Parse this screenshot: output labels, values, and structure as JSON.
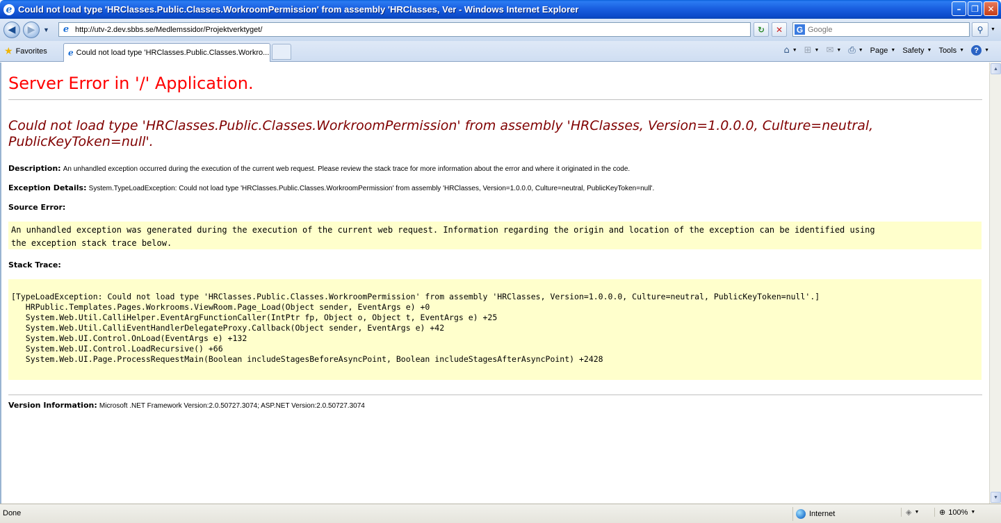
{
  "window": {
    "title": "Could not load type 'HRClasses.Public.Classes.WorkroomPermission' from assembly 'HRClasses, Ver - Windows Internet Explorer",
    "minimize": "–",
    "maximize": "❐",
    "close": "✕"
  },
  "address": {
    "back": "◀",
    "forward": "▶",
    "url": "http://utv-2.dev.sbbs.se/Medlemssidor/Projektverktyget/",
    "refresh": "↻",
    "stop": "✕"
  },
  "search": {
    "engine_icon": "G",
    "placeholder": "Google",
    "go": "⚲"
  },
  "favorites": {
    "label": "Favorites"
  },
  "tab": {
    "title": "Could not load type 'HRClasses.Public.Classes.Workro..."
  },
  "commandbar": {
    "page": "Page",
    "safety": "Safety",
    "tools": "Tools",
    "help": "?"
  },
  "page": {
    "heading": "Server Error in '/' Application.",
    "message": "Could not load type 'HRClasses.Public.Classes.WorkroomPermission' from assembly 'HRClasses, Version=1.0.0.0, Culture=neutral, PublicKeyToken=null'.",
    "description_label": "Description:",
    "description_text": "An unhandled exception occurred during the execution of the current web request. Please review the stack trace for more information about the error and where it originated in the code.",
    "exception_label": "Exception Details:",
    "exception_text": "System.TypeLoadException: Could not load type 'HRClasses.Public.Classes.WorkroomPermission' from assembly 'HRClasses, Version=1.0.0.0, Culture=neutral, PublicKeyToken=null'.",
    "source_label": "Source Error:",
    "source_text": "An unhandled exception was generated during the execution of the current web request. Information regarding the origin and location of the exception can be identified using\nthe exception stack trace below.",
    "stack_label": "Stack Trace:",
    "stack_text": "[TypeLoadException: Could not load type 'HRClasses.Public.Classes.WorkroomPermission' from assembly 'HRClasses, Version=1.0.0.0, Culture=neutral, PublicKeyToken=null'.]\n   HRPublic.Templates.Pages.Workrooms.ViewRoom.Page_Load(Object sender, EventArgs e) +0\n   System.Web.Util.CalliHelper.EventArgFunctionCaller(IntPtr fp, Object o, Object t, EventArgs e) +25\n   System.Web.Util.CalliEventHandlerDelegateProxy.Callback(Object sender, EventArgs e) +42\n   System.Web.UI.Control.OnLoad(EventArgs e) +132\n   System.Web.UI.Control.LoadRecursive() +66\n   System.Web.UI.Page.ProcessRequestMain(Boolean includeStagesBeforeAsyncPoint, Boolean includeStagesAfterAsyncPoint) +2428",
    "version_label": "Version Information:",
    "version_text": "Microsoft .NET Framework Version:2.0.50727.3074; ASP.NET Version:2.0.50727.3074"
  },
  "status": {
    "text": "Done",
    "zone": "Internet",
    "zoom": "100%"
  },
  "colors": {
    "heading": "#ff0000",
    "message": "#800000",
    "code_background": "#ffffcc"
  }
}
